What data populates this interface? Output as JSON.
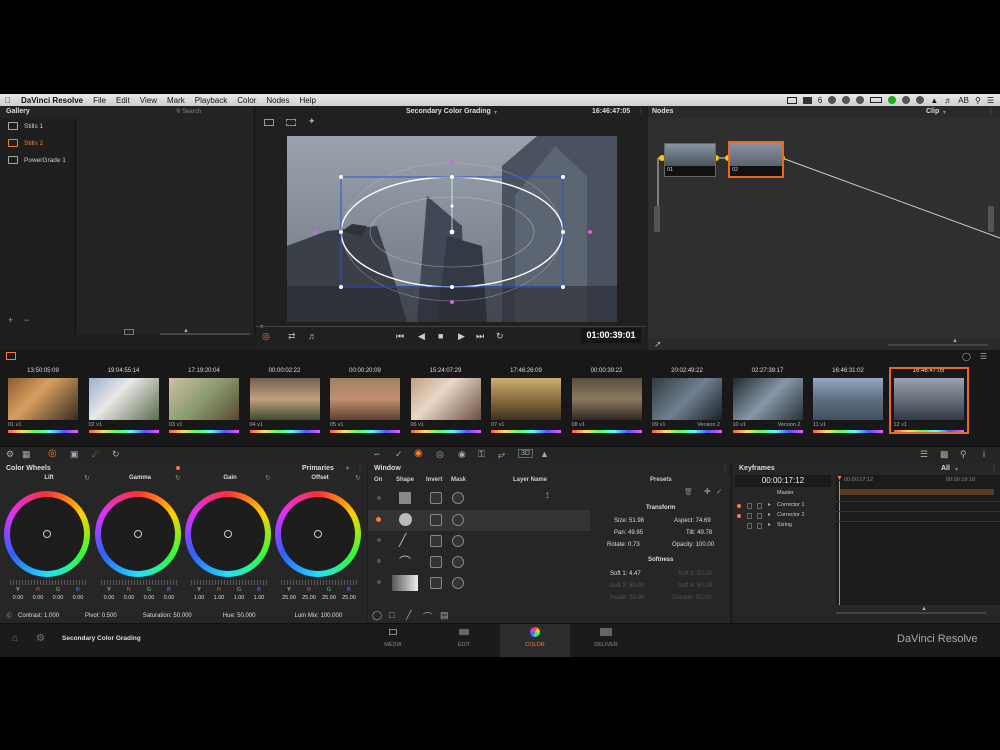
{
  "menubar": {
    "app": "DaVinci Resolve",
    "items": [
      "File",
      "Edit",
      "View",
      "Mark",
      "Playback",
      "Color",
      "Nodes",
      "Help"
    ],
    "status_num": "6",
    "user": "AB"
  },
  "gallery": {
    "title": "Gallery",
    "search": "Search",
    "items": [
      "Stills 1",
      "Stills 2",
      "PowerGrade 1"
    ]
  },
  "viewer": {
    "title": "Secondary Color Grading",
    "time": "16:46:47:05",
    "timecode": "01:00:39:01"
  },
  "nodes": {
    "title": "Nodes",
    "clip": "Clip",
    "node1": "01",
    "node2": "02"
  },
  "clips": [
    {
      "tc": "13:50:05:09",
      "num": "01",
      "track": "v1"
    },
    {
      "tc": "19:04:55:14",
      "num": "02",
      "track": "v1"
    },
    {
      "tc": "17:19:20:04",
      "num": "03",
      "track": "v1"
    },
    {
      "tc": "00:00:02:22",
      "num": "04",
      "track": "v1"
    },
    {
      "tc": "00:00:20:09",
      "num": "05",
      "track": "v1"
    },
    {
      "tc": "15:24:07:29",
      "num": "06",
      "track": "v1"
    },
    {
      "tc": "17:46:26:09",
      "num": "07",
      "track": "v1"
    },
    {
      "tc": "00:00:39:22",
      "num": "08",
      "track": "v1"
    },
    {
      "tc": "20:02:49:22",
      "num": "09",
      "track": "v1",
      "version": "Version 2"
    },
    {
      "tc": "02:27:39:17",
      "num": "10",
      "track": "v1",
      "version": "Version 2"
    },
    {
      "tc": "16:46:31:02",
      "num": "11",
      "track": "v1"
    },
    {
      "tc": "16:46:47:05",
      "num": "12",
      "track": "v1"
    }
  ],
  "wheels": {
    "title": "Color Wheels",
    "mode": "Primaries",
    "items": [
      {
        "name": "Lift",
        "y": "0.00",
        "r": "0.00",
        "g": "0.00",
        "b": "0.00"
      },
      {
        "name": "Gamma",
        "y": "0.00",
        "r": "0.00",
        "g": "0.00",
        "b": "0.00"
      },
      {
        "name": "Gain",
        "y": "1.00",
        "r": "1.00",
        "g": "1.00",
        "b": "1.00"
      },
      {
        "name": "Offset",
        "y": "25.00",
        "r": "25.00",
        "g": "25.00",
        "b": "25.00"
      }
    ],
    "channels": [
      "Y",
      "R",
      "G",
      "B"
    ],
    "contrast": "Contrast: 1.000",
    "pivot": "Pivot: 0.500",
    "saturation": "Saturation: 50.000",
    "hue": "Hue: 50.000",
    "lummix": "Lum Mix: 100.000"
  },
  "window": {
    "title": "Window",
    "cols": {
      "on": "On",
      "shape": "Shape",
      "invert": "Invert",
      "mask": "Mask",
      "layer": "Layer Name"
    },
    "presets": "Presets",
    "transform": "Transform",
    "size": "Size: 51.98",
    "aspect": "Aspect: 74.69",
    "pan": "Pan: 49.95",
    "tilt": "Tilt: 49.78",
    "rotate": "Rotate: 0.73",
    "opacity": "Opacity: 100.00",
    "softness": "Softness",
    "soft1": "Soft 1: 4.47",
    "soft2": "Soft 2: 50.00",
    "soft3": "Soft 3: 50.00",
    "soft4": "Soft 4: 50.00",
    "inside": "Inside: 50.00",
    "outside": "Outside: 50.00"
  },
  "keyframes": {
    "title": "Keyframes",
    "filter": "All",
    "time": "00:00:17:12",
    "ruler1": "00:00:17:12",
    "ruler2": "00:00:18:18",
    "tracks": [
      "Master",
      "Corrector 1",
      "Corrector 2",
      "Sizing"
    ]
  },
  "status": {
    "page": "Secondary Color Grading",
    "tabs": [
      "MEDIA",
      "EDIT",
      "COLOR",
      "DELIVER"
    ],
    "brand": "DaVinci Resolve"
  },
  "colors": {
    "accent": "#ff7a2e",
    "selected": "#e86a1e"
  }
}
